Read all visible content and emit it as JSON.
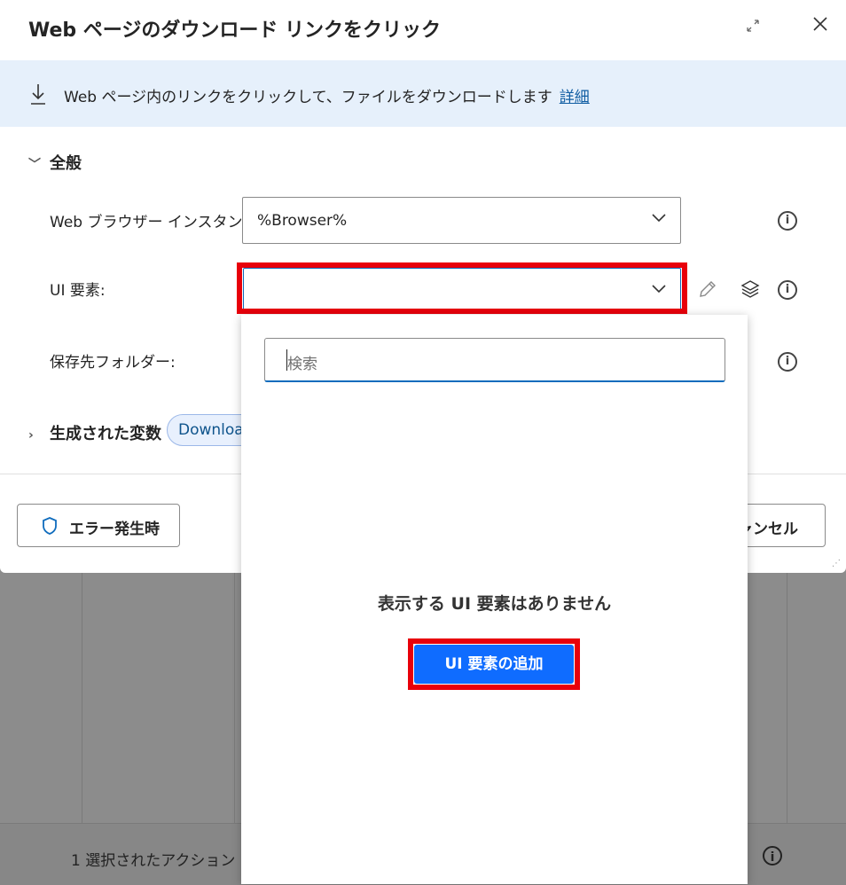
{
  "dialog": {
    "title": "Web ページのダウンロード リンクをクリック",
    "banner_text": "Web ページ内のリンクをクリックして、ファイルをダウンロードします",
    "banner_link": "詳細"
  },
  "general": {
    "section_label": "全般",
    "browser_label": "Web ブラウザー インスタンス:",
    "browser_value": "%Browser%",
    "ui_element_label": "UI 要素:",
    "ui_element_value": "",
    "folder_label": "保存先フォルダー:"
  },
  "variables": {
    "section_label": "生成された変数",
    "pill": "Downloa"
  },
  "footer": {
    "error_button": "エラー発生時",
    "cancel_button": "ャンセル"
  },
  "popup": {
    "search_placeholder": "検索",
    "empty_message": "表示する UI 要素はありません",
    "add_button": "UI 要素の追加"
  },
  "background": {
    "status_text": "1 選択されたアクション"
  },
  "colors": {
    "highlight": "#e8000b",
    "primary": "#0f6cff",
    "banner_bg": "#e6f0fb"
  }
}
